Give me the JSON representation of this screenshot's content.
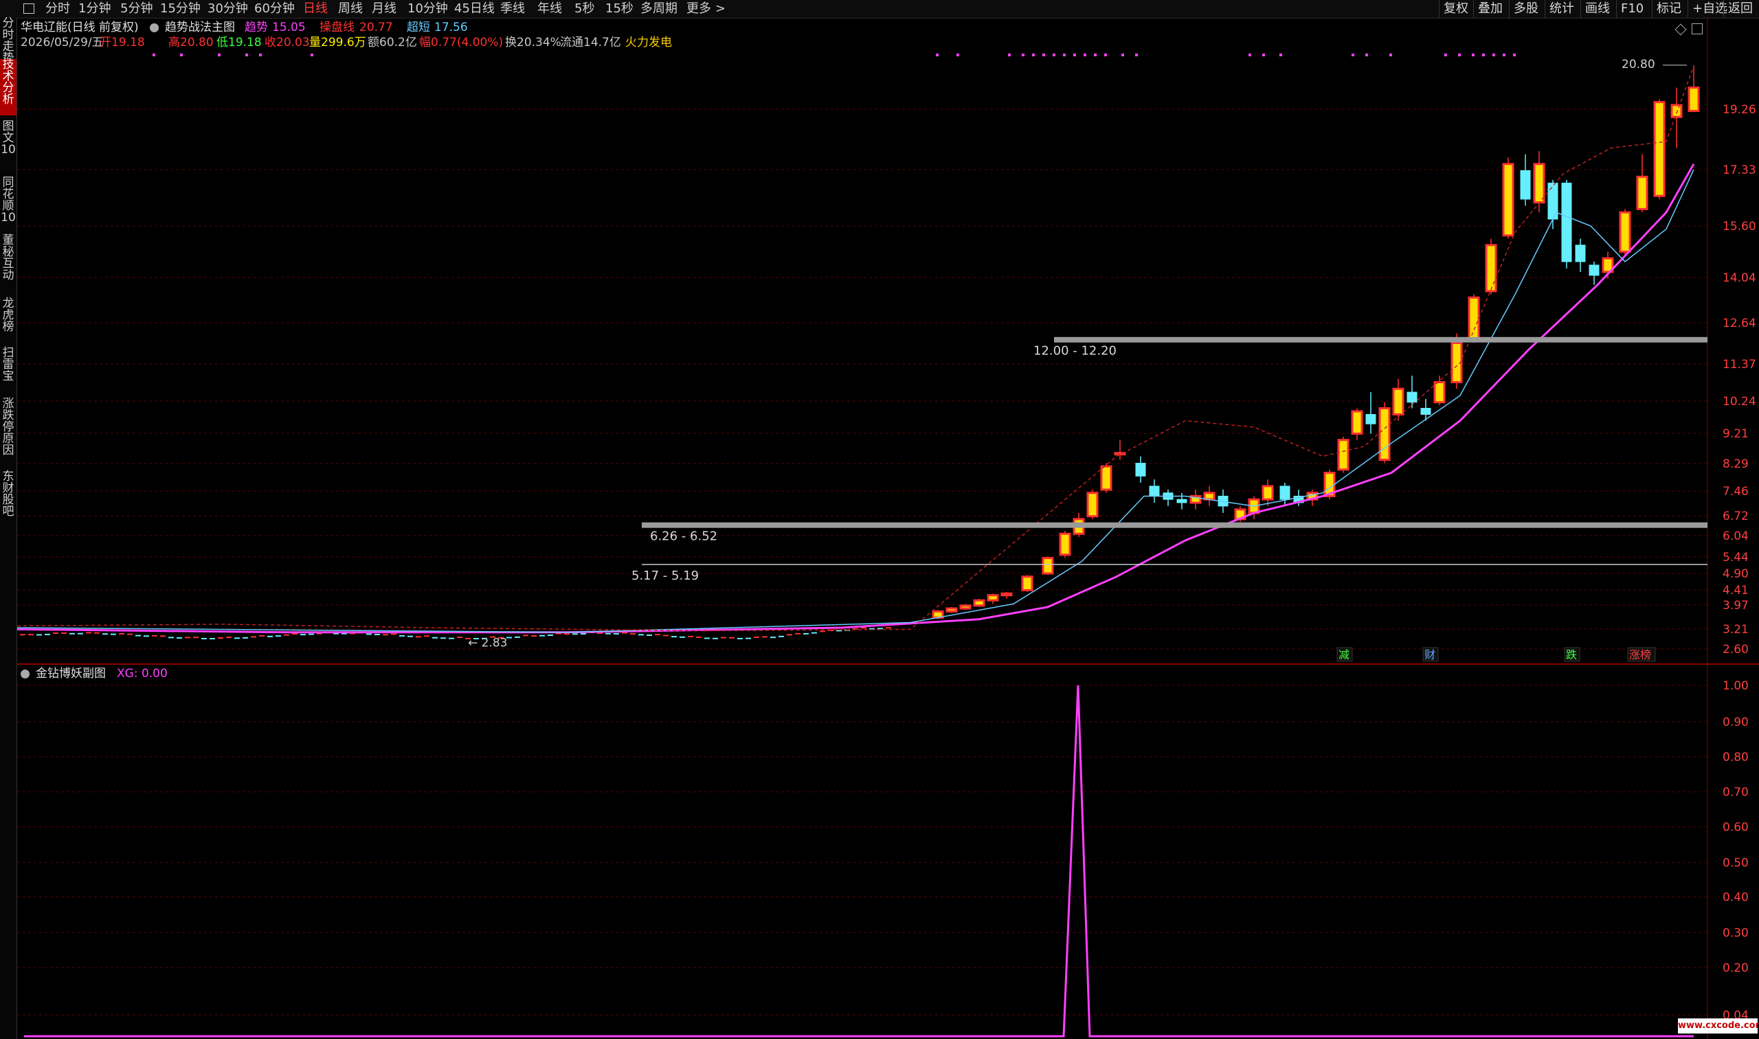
{
  "toolbar": {
    "periods": [
      "分时",
      "1分钟",
      "5分钟",
      "15分钟",
      "30分钟",
      "60分钟",
      "日线",
      "周线",
      "月线",
      "10分钟",
      "45日线",
      "季线",
      "年线",
      "5秒",
      "15秒",
      "多周期",
      "更多 >"
    ],
    "active_period": "日线",
    "right_buttons": [
      "复权",
      "叠加",
      "多股",
      "统计",
      "画线",
      "F10",
      "标记",
      "+自选",
      "返回"
    ]
  },
  "sidebar": {
    "items": [
      "分时走势",
      "技术分析",
      "图文10",
      "同花顺10",
      "董秘互动",
      "龙虎榜",
      "扫雷宝",
      "涨跌停原因",
      "东财股吧"
    ],
    "active": "技术分析"
  },
  "main_chart": {
    "stock_name": "华电辽能(日线 前复权)",
    "indicator_name": "趋势战法主图",
    "ind_values": [
      {
        "label": "趋势",
        "value": "15.05",
        "color": "#ff40ff"
      },
      {
        "label": "操盘线",
        "value": "20.77",
        "color": "#ff3030"
      },
      {
        "label": "超短",
        "value": "17.56",
        "color": "#66ccff"
      }
    ],
    "bar_info": {
      "date": "2026/05/29/五",
      "open_label": "开",
      "open": "19.18",
      "high_label": "高",
      "high": "20.80",
      "low_label": "低",
      "low": "19.18",
      "close_label": "收",
      "close": "20.03",
      "vol_label": "量",
      "vol": "299.6万",
      "amount_label": "额",
      "amount": "60.2亿",
      "change_label": "幅",
      "change": "0.77(4.00%)",
      "turnover_label": "换",
      "turnover": "20.34%",
      "float_label": "流通",
      "float": "14.7亿",
      "industry": "火力发电"
    },
    "y_axis_ticks": [
      "19.26",
      "17.33",
      "15.60",
      "14.04",
      "12.64",
      "11.37",
      "10.24",
      "9.21",
      "8.29",
      "7.46",
      "6.72",
      "6.04",
      "5.44",
      "4.90",
      "4.41",
      "3.97",
      "3.21",
      "2.60"
    ],
    "high_marker": "20.80",
    "low_marker": "2.83",
    "zones": [
      "12.00 - 12.20",
      "6.26 - 6.52",
      "5.17 - 5.19"
    ],
    "event_tags": [
      {
        "text": "减",
        "color": "#40ff40"
      },
      {
        "text": "财",
        "color": "#66aaff"
      },
      {
        "text": "跌",
        "color": "#40ff40"
      },
      {
        "text": "涨榜",
        "color": "#ff4040"
      }
    ],
    "colors": {
      "up": "#ff3030",
      "fill_up": "#ffdd00",
      "down": "#66eeff",
      "trend": "#ff40ff",
      "short": "#66ccff",
      "grid": "#6a0000"
    }
  },
  "sub_chart": {
    "name": "金钻博妖副图",
    "value_label": "XG: 0.00",
    "y_axis_ticks": [
      "1.00",
      "0.90",
      "0.80",
      "0.70",
      "0.60",
      "0.50",
      "0.40",
      "0.30",
      "0.20",
      "0.04"
    ],
    "watermark": "www.cxcode.com"
  }
}
